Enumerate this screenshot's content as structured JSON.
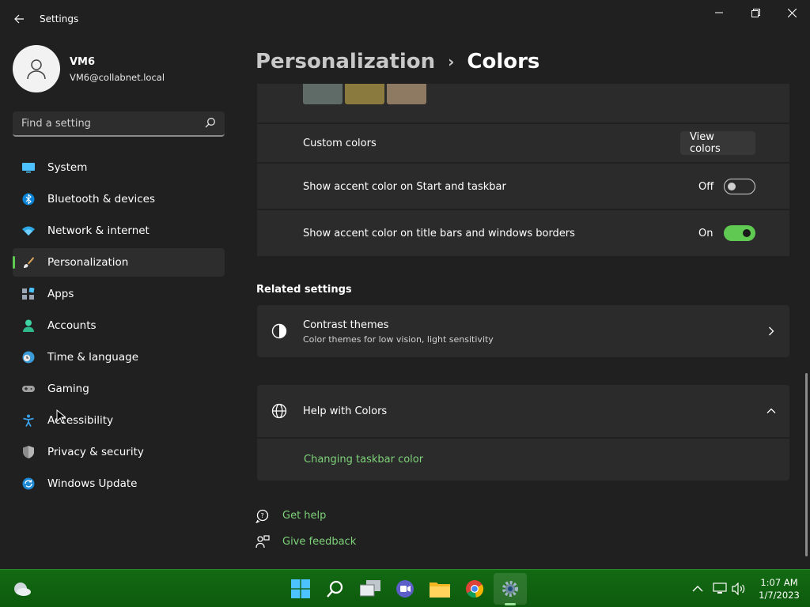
{
  "window": {
    "title": "Settings",
    "controls": {
      "minimize": "minimize",
      "maximize": "restore",
      "close": "close"
    }
  },
  "profile": {
    "name": "VM6",
    "email": "VM6@collabnet.local"
  },
  "search": {
    "placeholder": "Find a setting"
  },
  "sidebar": {
    "items": [
      {
        "label": "System",
        "icon": "monitor-icon"
      },
      {
        "label": "Bluetooth & devices",
        "icon": "bluetooth-icon"
      },
      {
        "label": "Network & internet",
        "icon": "wifi-icon"
      },
      {
        "label": "Personalization",
        "icon": "paintbrush-icon",
        "active": true
      },
      {
        "label": "Apps",
        "icon": "apps-icon"
      },
      {
        "label": "Accounts",
        "icon": "person-icon"
      },
      {
        "label": "Time & language",
        "icon": "clock-globe-icon"
      },
      {
        "label": "Gaming",
        "icon": "gamepad-icon"
      },
      {
        "label": "Accessibility",
        "icon": "accessibility-icon"
      },
      {
        "label": "Privacy & security",
        "icon": "shield-icon"
      },
      {
        "label": "Windows Update",
        "icon": "update-icon"
      }
    ]
  },
  "breadcrumb": {
    "parent": "Personalization",
    "separator": "›",
    "current": "Colors"
  },
  "swatches": [
    "#5f6b66",
    "#8a7a3e",
    "#8e7a62"
  ],
  "custom_colors": {
    "label": "Custom colors",
    "button": "View colors"
  },
  "accent_start_taskbar": {
    "label": "Show accent color on Start and taskbar",
    "state_text": "Off",
    "on": false
  },
  "accent_title_bars": {
    "label": "Show accent color on title bars and windows borders",
    "state_text": "On",
    "on": true
  },
  "related": {
    "heading": "Related settings",
    "contrast": {
      "title": "Contrast themes",
      "subtitle": "Color themes for low vision, light sensitivity"
    }
  },
  "help": {
    "title": "Help with Colors",
    "link": "Changing taskbar color"
  },
  "footer_links": {
    "get_help": "Get help",
    "feedback": "Give feedback"
  },
  "taskbar": {
    "apps": [
      "start-icon",
      "search-icon",
      "task-view-icon",
      "chat-icon",
      "file-explorer-icon",
      "chrome-icon",
      "settings-icon"
    ],
    "time": "1:07 AM",
    "date": "1/7/2023"
  },
  "colors": {
    "accent": "#60c952",
    "link": "#7ed37a",
    "taskbar": "#136a13",
    "background": "#202020",
    "card": "#2b2b2b"
  }
}
